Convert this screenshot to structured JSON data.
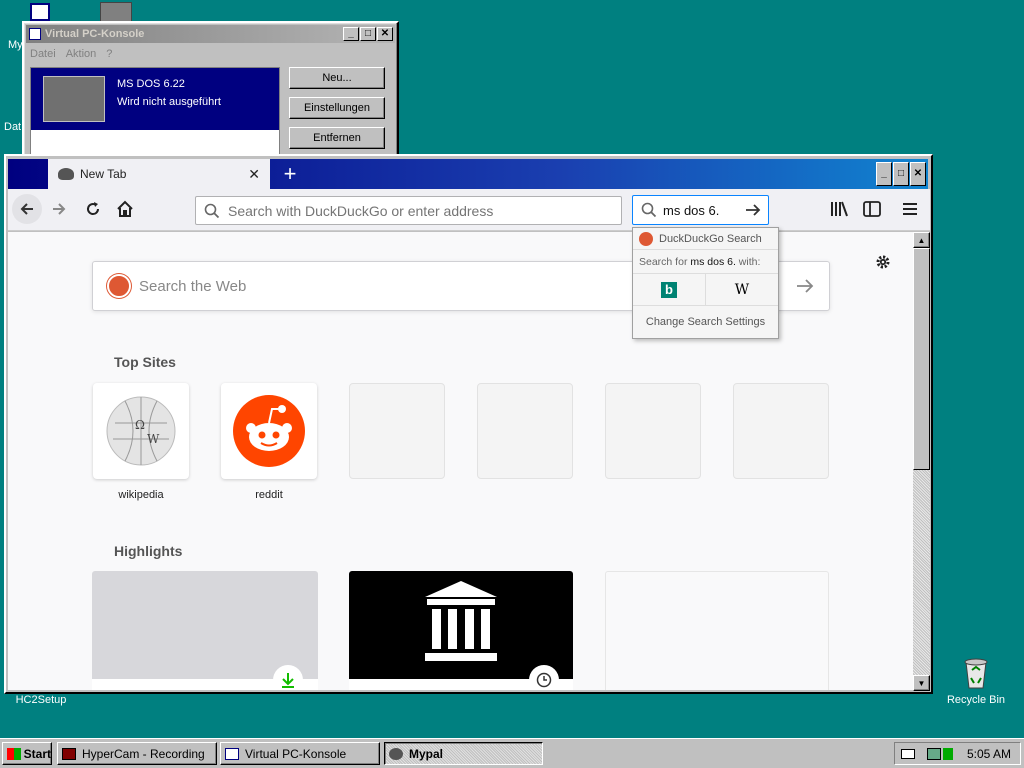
{
  "desktop": {
    "icons": [
      {
        "label": "HC2Setup"
      },
      {
        "label": "Recycle Bin"
      }
    ],
    "fragments": [
      "My",
      "Dat"
    ]
  },
  "vpc": {
    "title": "Virtual PC-Konsole",
    "menu": [
      "Datei",
      "Aktion",
      "?"
    ],
    "vm_name": "MS DOS 6.22",
    "vm_status": "Wird nicht ausgeführt",
    "buttons": {
      "new": "Neu...",
      "settings": "Einstellungen",
      "remove": "Entfernen"
    }
  },
  "firefox": {
    "tab_title": "New Tab",
    "tab_close": "✕",
    "new_tab": "+",
    "url_placeholder": "Search with DuckDuckGo or enter address",
    "search_value": "ms dos 6.",
    "search_popup": {
      "engine": "DuckDuckGo Search",
      "search_for_prefix": "Search for ",
      "search_for_query": "ms dos 6.",
      "search_for_suffix": " with:",
      "change_settings": "Change Search Settings",
      "engines": [
        {
          "name": "bing",
          "glyph": "b"
        },
        {
          "name": "wikipedia",
          "glyph": "W"
        }
      ]
    },
    "newtab": {
      "search_placeholder": "Search the Web",
      "top_sites_title": "Top Sites",
      "highlights_title": "Highlights",
      "top_sites": [
        {
          "label": "wikipedia"
        },
        {
          "label": "reddit"
        }
      ]
    }
  },
  "taskbar": {
    "start": "Start",
    "tasks": [
      {
        "label": "HyperCam - Recording"
      },
      {
        "label": "Virtual PC-Konsole"
      },
      {
        "label": "Mypal"
      }
    ],
    "clock": "5:05 AM"
  },
  "colors": {
    "desktop": "#008080",
    "title_active": "#000080",
    "ddg_orange": "#de5833",
    "reddit_orange": "#ff4500",
    "bing_teal": "#008373"
  }
}
